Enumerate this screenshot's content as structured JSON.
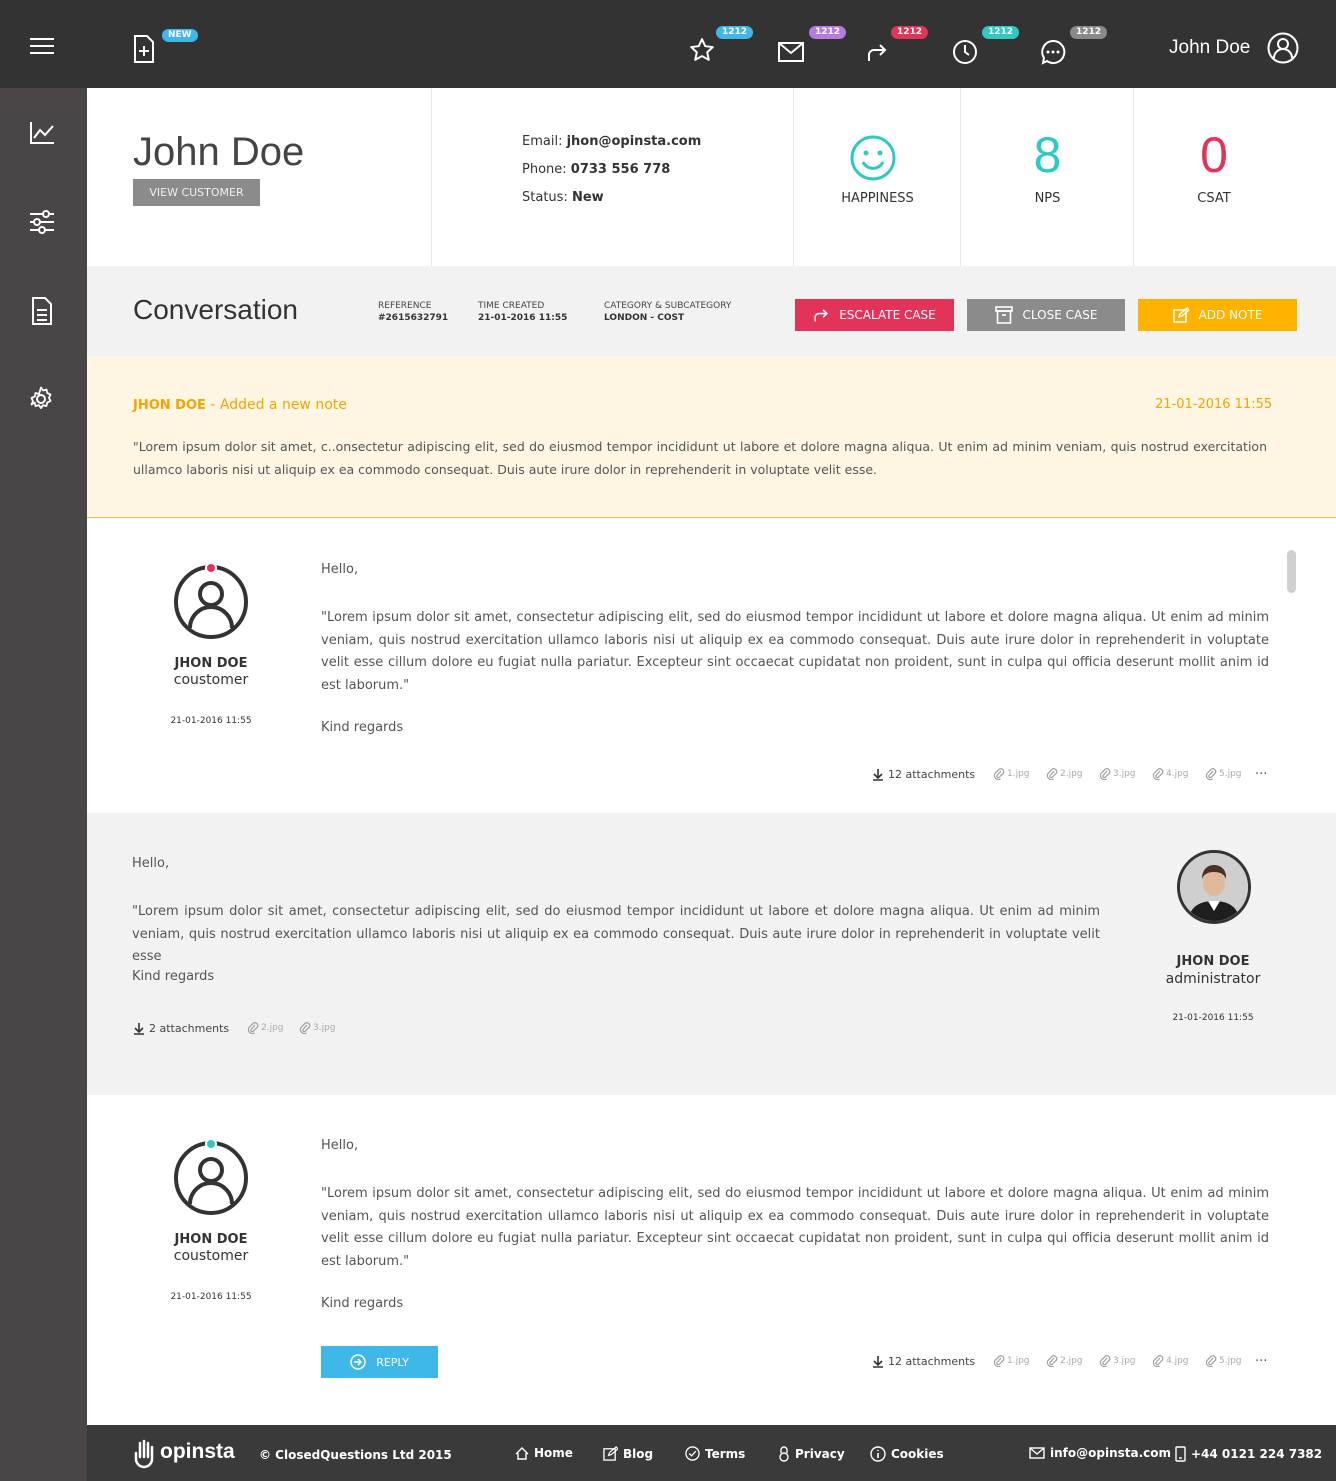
{
  "topbar": {
    "new_badge": "NEW",
    "notifications": [
      {
        "icon": "star-icon",
        "count": "1212",
        "color": "#3fb7e8"
      },
      {
        "icon": "mail-icon",
        "count": "1212",
        "color": "#b57be0"
      },
      {
        "icon": "forward-icon",
        "count": "1212",
        "color": "#e2335a"
      },
      {
        "icon": "clock-icon",
        "count": "1212",
        "color": "#2ec9c3"
      },
      {
        "icon": "chat-icon",
        "count": "1212",
        "color": "#8a8a8a"
      }
    ],
    "user_name": "John Doe"
  },
  "customer": {
    "name": "John Doe",
    "view_button": "VIEW CUSTOMER",
    "email_label": "Email:",
    "email": "jhon@opinsta.com",
    "phone_label": "Phone:",
    "phone": "0733 556 778",
    "status_label": "Status:",
    "status": "New"
  },
  "metrics": {
    "happiness_label": "HAPPINESS",
    "nps_value": "8",
    "nps_label": "NPS",
    "csat_value": "0",
    "csat_label": "CSAT",
    "nps_color": "#2ec9c3",
    "csat_color": "#e2335a"
  },
  "conversation": {
    "title": "Conversation",
    "reference_label": "REFERENCE",
    "reference": "#2615632791",
    "time_label": "TIME CREATED",
    "time": "21-01-2016 11:55",
    "category_label": "CATEGORY & SUBCATEGORY",
    "category": "LONDON - COST",
    "escalate": "ESCALATE CASE",
    "close": "CLOSE CASE",
    "add_note": "ADD NOTE"
  },
  "note": {
    "author": "JHON DOE",
    "action": " - Added a new note",
    "date": "21-01-2016 11:55",
    "text": "\"Lorem ipsum dolor sit amet, c..onsectetur adipiscing elit, sed do eiusmod tempor incididunt ut labore et dolore magna aliqua. Ut enim ad minim veniam, quis nostrud exercitation ullamco laboris nisi ut aliquip ex ea commodo consequat. Duis aute irure dolor in reprehenderit in voluptate velit esse."
  },
  "messages": [
    {
      "greeting": "Hello,",
      "body": "\"Lorem ipsum dolor sit amet, consectetur adipiscing elit, sed do eiusmod tempor incididunt ut labore et dolore magna aliqua. Ut enim ad minim veniam, quis nostrud exercitation ullamco laboris nisi ut aliquip ex ea commodo consequat. Duis aute irure dolor in reprehenderit in voluptate velit esse cillum dolore eu fugiat nulla pariatur. Excepteur sint occaecat cupidatat non proident, sunt in culpa qui officia deserunt mollit anim id est laborum.\"",
      "signoff": "Kind regards",
      "name": "JHON DOE",
      "role": "coustomer",
      "date": "21-01-2016 11:55",
      "attachments": "12 attachments",
      "files": [
        "1.jpg",
        "2.jpg",
        "3.jpg",
        "4.jpg",
        "5.jpg"
      ],
      "more": "...",
      "dot_color": "#e2335a"
    },
    {
      "greeting": "Hello,",
      "body": "\"Lorem ipsum dolor sit amet, consectetur adipiscing elit, sed do eiusmod tempor incididunt ut labore et dolore magna aliqua. Ut enim ad minim veniam, quis nostrud exercitation ullamco laboris nisi ut aliquip ex ea commodo consequat. Duis aute irure dolor in reprehenderit in voluptate velit esse",
      "signoff": "Kind regards",
      "name": "JHON DOE",
      "role": "administrator",
      "date": "21-01-2016 11:55",
      "attachments": "2 attachments",
      "files": [
        "2.jpg",
        "3.jpg"
      ]
    },
    {
      "greeting": "Hello,",
      "body": "\"Lorem ipsum dolor sit amet, consectetur adipiscing elit, sed do eiusmod tempor incididunt ut labore et dolore magna aliqua. Ut enim ad minim veniam, quis nostrud exercitation ullamco laboris nisi ut aliquip ex ea commodo consequat. Duis aute irure dolor in reprehenderit in voluptate velit esse cillum dolore eu fugiat nulla pariatur. Excepteur sint occaecat cupidatat non proident, sunt in culpa qui officia deserunt mollit anim id est laborum.\"",
      "signoff": "Kind regards",
      "name": "JHON DOE",
      "role": "coustomer",
      "date": "21-01-2016 11:55",
      "attachments": "12 attachments",
      "files": [
        "1.jpg",
        "2.jpg",
        "3.jpg",
        "4.jpg",
        "5.jpg"
      ],
      "more": "...",
      "reply": "REPLY",
      "dot_color": "#2ec9c3"
    }
  ],
  "footer": {
    "brand": "opinsta",
    "copyright": "© ClosedQuestions Ltd 2015",
    "links": [
      "Home",
      "Blog",
      "Terms",
      "Privacy",
      "Cookies"
    ],
    "email": "info@opinsta.com",
    "phone": "+44 0121 224 7382"
  }
}
